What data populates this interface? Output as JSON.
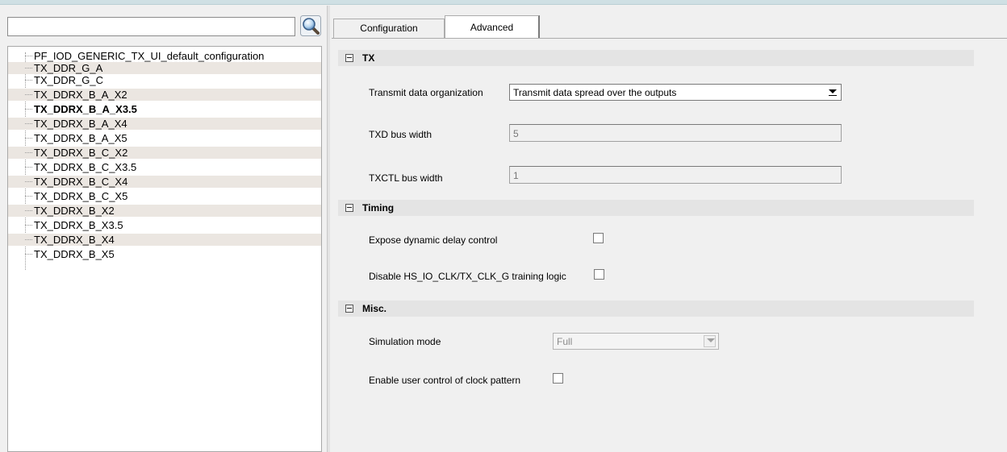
{
  "search": {
    "value": ""
  },
  "tree": {
    "items": [
      "PF_IOD_GENERIC_TX_UI_default_configuration",
      "TX_DDR_G_A",
      "TX_DDR_G_C",
      "TX_DDRX_B_A_X2",
      "TX_DDRX_B_A_X3.5",
      "TX_DDRX_B_A_X4",
      "TX_DDRX_B_A_X5",
      "TX_DDRX_B_C_X2",
      "TX_DDRX_B_C_X3.5",
      "TX_DDRX_B_C_X4",
      "TX_DDRX_B_C_X5",
      "TX_DDRX_B_X2",
      "TX_DDRX_B_X3.5",
      "TX_DDRX_B_X4",
      "TX_DDRX_B_X5"
    ],
    "selected": "TX_DDRX_B_A_X3.5"
  },
  "tabs": {
    "configuration": "Configuration",
    "advanced": "Advanced",
    "active": "Advanced"
  },
  "tx": {
    "title": "TX",
    "data_org_label": "Transmit data organization",
    "data_org_value": "Transmit data spread over the outputs",
    "txd_label": "TXD bus width",
    "txd_value": "5",
    "txctl_label": "TXCTL bus width",
    "txctl_value": "1"
  },
  "timing": {
    "title": "Timing",
    "dyn_delay_label": "Expose dynamic delay control",
    "dyn_delay_checked": false,
    "disable_training_label": "Disable HS_IO_CLK/TX_CLK_G training logic",
    "disable_training_checked": false
  },
  "misc": {
    "title": "Misc.",
    "sim_mode_label": "Simulation mode",
    "sim_mode_value": "Full",
    "clock_pattern_label": "Enable user control of clock pattern",
    "clock_pattern_checked": false
  }
}
